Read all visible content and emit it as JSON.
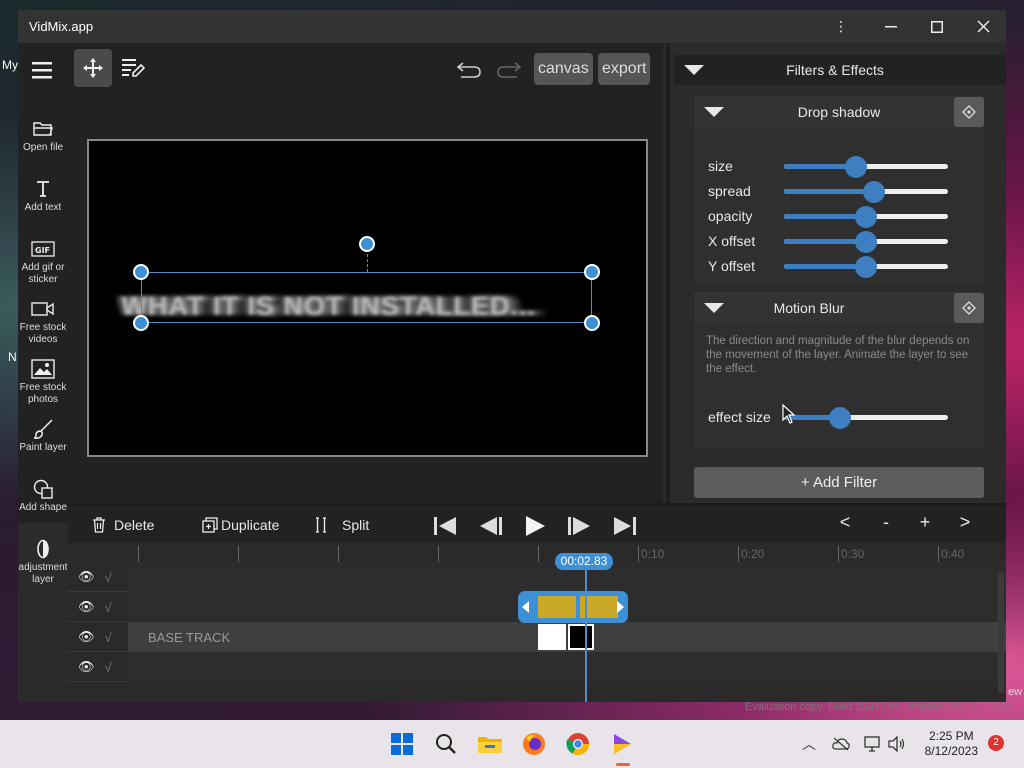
{
  "window": {
    "title": "VidMix.app"
  },
  "toolbar": {
    "canvas_label": "canvas",
    "export_label": "export"
  },
  "side_tools": [
    {
      "label": "Open file",
      "icon": "folder-icon"
    },
    {
      "label": "Add text",
      "icon": "text-icon"
    },
    {
      "label": "Add gif or sticker",
      "icon": "gif-icon"
    },
    {
      "label": "Free stock videos",
      "icon": "video-camera-icon"
    },
    {
      "label": "Free stock photos",
      "icon": "image-icon"
    },
    {
      "label": "Paint layer",
      "icon": "brush-icon"
    },
    {
      "label": "Add shape",
      "icon": "shape-icon"
    },
    {
      "label": "adjustment layer",
      "icon": "adjustment-icon"
    }
  ],
  "canvas": {
    "layer_text": "WHAT IT IS NOT INSTALLED..."
  },
  "panel": {
    "header": "Filters & Effects",
    "drop_shadow": {
      "title": "Drop shadow",
      "sliders": [
        {
          "label": "size",
          "value": 0.44
        },
        {
          "label": "spread",
          "value": 0.55
        },
        {
          "label": "opacity",
          "value": 0.5
        },
        {
          "label": "X offset",
          "value": 0.5
        },
        {
          "label": "Y offset",
          "value": 0.5
        }
      ]
    },
    "motion_blur": {
      "title": "Motion Blur",
      "description": "The direction and magnitude of the blur depends on the movement of the layer. Animate the layer to see the effect.",
      "slider": {
        "label": "effect size",
        "value": 0.34
      }
    },
    "add_filter_label": "+ Add Filter"
  },
  "timeline_controls": {
    "delete_label": "Delete",
    "duplicate_label": "Duplicate",
    "split_label": "Split",
    "prev_label": "<",
    "zoom_out_label": "-",
    "zoom_in_label": "+",
    "next_label": ">"
  },
  "timeline": {
    "current_time": "00:02.83",
    "ruler_ticks": [
      "",
      "",
      "",
      "",
      "",
      "0:10",
      "0:20",
      "0:30",
      "0:40"
    ],
    "base_track_label": "BASE TRACK"
  },
  "watermark": "Evaluation copy. Build 25375.zn_release.230520-1632",
  "taskbar": {
    "time": "2:25 PM",
    "date": "8/12/2023",
    "notifications": "2"
  },
  "colors": {
    "accent": "#3d8fd6",
    "clip": "#c9a82a",
    "panel": "#2b2b2b"
  }
}
